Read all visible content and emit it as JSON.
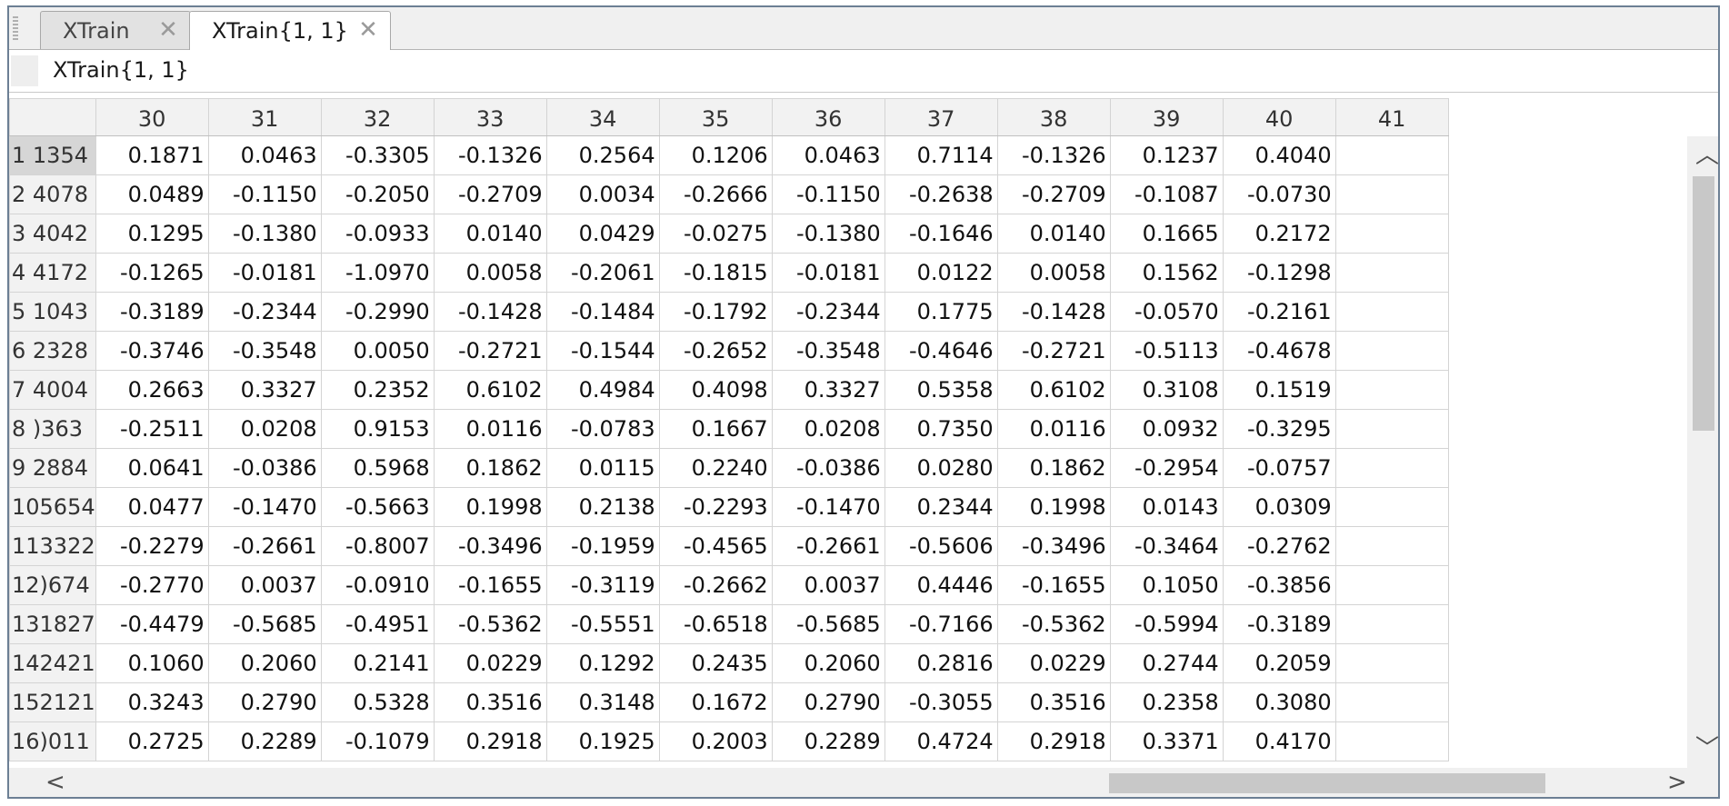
{
  "tabs": [
    {
      "label": "XTrain",
      "close": "✕"
    },
    {
      "label": "XTrain{1, 1}",
      "close": "✕"
    }
  ],
  "variable_name": "XTrain{1, 1}",
  "columns": [
    "",
    "30",
    "31",
    "32",
    "33",
    "34",
    "35",
    "36",
    "37",
    "38",
    "39",
    "40",
    "41"
  ],
  "rows": [
    {
      "label": "1 1354",
      "cells": [
        "0.1871",
        "0.0463",
        "-0.3305",
        "-0.1326",
        "0.2564",
        "0.1206",
        "0.0463",
        "0.7114",
        "-0.1326",
        "0.1237",
        "0.4040"
      ]
    },
    {
      "label": "2 4078",
      "cells": [
        "0.0489",
        "-0.1150",
        "-0.2050",
        "-0.2709",
        "0.0034",
        "-0.2666",
        "-0.1150",
        "-0.2638",
        "-0.2709",
        "-0.1087",
        "-0.0730"
      ]
    },
    {
      "label": "3 4042",
      "cells": [
        "0.1295",
        "-0.1380",
        "-0.0933",
        "0.0140",
        "0.0429",
        "-0.0275",
        "-0.1380",
        "-0.1646",
        "0.0140",
        "0.1665",
        "0.2172"
      ]
    },
    {
      "label": "4 4172",
      "cells": [
        "-0.1265",
        "-0.0181",
        "-1.0970",
        "0.0058",
        "-0.2061",
        "-0.1815",
        "-0.0181",
        "0.0122",
        "0.0058",
        "0.1562",
        "-0.1298"
      ]
    },
    {
      "label": "5 1043",
      "cells": [
        "-0.3189",
        "-0.2344",
        "-0.2990",
        "-0.1428",
        "-0.1484",
        "-0.1792",
        "-0.2344",
        "0.1775",
        "-0.1428",
        "-0.0570",
        "-0.2161"
      ]
    },
    {
      "label": "6 2328",
      "cells": [
        "-0.3746",
        "-0.3548",
        "0.0050",
        "-0.2721",
        "-0.1544",
        "-0.2652",
        "-0.3548",
        "-0.4646",
        "-0.2721",
        "-0.5113",
        "-0.4678"
      ]
    },
    {
      "label": "7 4004",
      "cells": [
        "0.2663",
        "0.3327",
        "0.2352",
        "0.6102",
        "0.4984",
        "0.4098",
        "0.3327",
        "0.5358",
        "0.6102",
        "0.3108",
        "0.1519"
      ]
    },
    {
      "label": "8 )363",
      "cells": [
        "-0.2511",
        "0.0208",
        "0.9153",
        "0.0116",
        "-0.0783",
        "0.1667",
        "0.0208",
        "0.7350",
        "0.0116",
        "0.0932",
        "-0.3295"
      ]
    },
    {
      "label": "9 2884",
      "cells": [
        "0.0641",
        "-0.0386",
        "0.5968",
        "0.1862",
        "0.0115",
        "0.2240",
        "-0.0386",
        "0.0280",
        "0.1862",
        "-0.2954",
        "-0.0757"
      ]
    },
    {
      "label": "105654",
      "cells": [
        "0.0477",
        "-0.1470",
        "-0.5663",
        "0.1998",
        "0.2138",
        "-0.2293",
        "-0.1470",
        "0.2344",
        "0.1998",
        "0.0143",
        "0.0309"
      ]
    },
    {
      "label": "113322",
      "cells": [
        "-0.2279",
        "-0.2661",
        "-0.8007",
        "-0.3496",
        "-0.1959",
        "-0.4565",
        "-0.2661",
        "-0.5606",
        "-0.3496",
        "-0.3464",
        "-0.2762"
      ]
    },
    {
      "label": "12)674",
      "cells": [
        "-0.2770",
        "0.0037",
        "-0.0910",
        "-0.1655",
        "-0.3119",
        "-0.2662",
        "0.0037",
        "0.4446",
        "-0.1655",
        "0.1050",
        "-0.3856"
      ]
    },
    {
      "label": "131827",
      "cells": [
        "-0.4479",
        "-0.5685",
        "-0.4951",
        "-0.5362",
        "-0.5551",
        "-0.6518",
        "-0.5685",
        "-0.7166",
        "-0.5362",
        "-0.5994",
        "-0.3189"
      ]
    },
    {
      "label": "142421",
      "cells": [
        "0.1060",
        "0.2060",
        "0.2141",
        "0.0229",
        "0.1292",
        "0.2435",
        "0.2060",
        "0.2816",
        "0.0229",
        "0.2744",
        "0.2059"
      ]
    },
    {
      "label": "152121",
      "cells": [
        "0.3243",
        "0.2790",
        "0.5328",
        "0.3516",
        "0.3148",
        "0.1672",
        "0.2790",
        "-0.3055",
        "0.3516",
        "0.2358",
        "0.3080"
      ]
    },
    {
      "label": "16)011",
      "cells": [
        "0.2725",
        "0.2289",
        "-0.1079",
        "0.2918",
        "0.1925",
        "0.2003",
        "0.2289",
        "0.4724",
        "0.2918",
        "0.3371",
        "0.4170"
      ]
    }
  ],
  "scroll_icons": {
    "up": "︿",
    "down": "﹀",
    "left": "<",
    "right": ">"
  }
}
